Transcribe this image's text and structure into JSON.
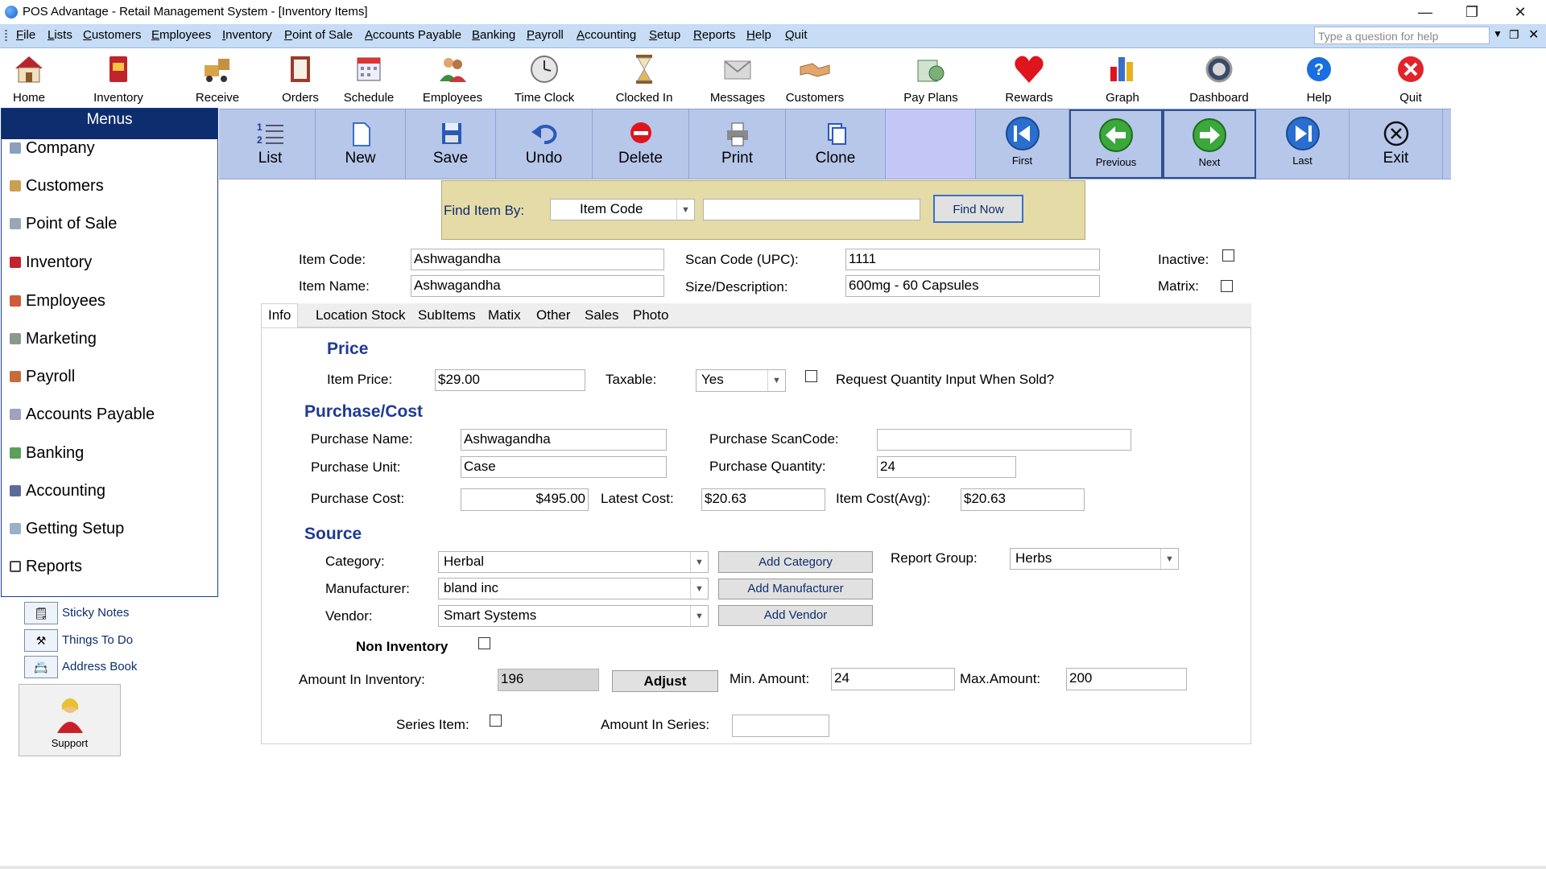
{
  "window": {
    "title": "POS Advantage - Retail Management System - [Inventory Items]",
    "controls": {
      "minimize": "—",
      "restore": "❐",
      "close": "✕"
    }
  },
  "menubar": {
    "items": [
      "File",
      "Lists",
      "Customers",
      "Employees",
      "Inventory",
      "Point of Sale",
      "Accounts Payable",
      "Banking",
      "Payroll",
      "Accounting",
      "Setup",
      "Reports",
      "Help",
      "Quit"
    ],
    "help_placeholder": "Type a question for help"
  },
  "toolbar": {
    "buttons": [
      {
        "label": "Home",
        "icon": "house-icon"
      },
      {
        "label": "Inventory",
        "icon": "book-icon"
      },
      {
        "label": "Receive",
        "icon": "forklift-icon"
      },
      {
        "label": "Orders",
        "icon": "notebook-icon"
      },
      {
        "label": "Schedule",
        "icon": "calendar-icon"
      },
      {
        "label": "Employees",
        "icon": "people-icon"
      },
      {
        "label": "Time Clock",
        "icon": "clock-icon"
      },
      {
        "label": "Clocked In",
        "icon": "hourglass-icon"
      },
      {
        "label": "Messages",
        "icon": "envelope-icon"
      },
      {
        "label": "Customers",
        "icon": "handshake-icon"
      },
      {
        "label": "Pay Plans",
        "icon": "money-icon"
      },
      {
        "label": "Rewards",
        "icon": "heart-icon"
      },
      {
        "label": "Graph",
        "icon": "bar-chart-icon"
      },
      {
        "label": "Dashboard",
        "icon": "gauge-icon"
      },
      {
        "label": "Help",
        "icon": "question-icon"
      },
      {
        "label": "Quit",
        "icon": "close-circle-icon"
      }
    ]
  },
  "leftpanel": {
    "header": "Menus",
    "items": [
      "Company",
      "Customers",
      "Point of Sale",
      "Inventory",
      "Employees",
      "Marketing",
      "Payroll",
      "Accounts Payable",
      "Banking",
      "Accounting",
      "Getting Setup",
      "Reports"
    ],
    "links": [
      "Sticky Notes",
      "Things To Do",
      "Address Book"
    ],
    "support": "Support"
  },
  "recordbar": {
    "list": "List",
    "new": "New",
    "save": "Save",
    "undo": "Undo",
    "delete": "Delete",
    "print": "Print",
    "clone": "Clone",
    "first": "First",
    "previous": "Previous",
    "next": "Next",
    "last": "Last",
    "exit": "Exit"
  },
  "find": {
    "label": "Find Item By:",
    "by_value": "Item Code",
    "search_value": "",
    "button": "Find Now"
  },
  "item": {
    "code_label": "Item Code:",
    "code": "Ashwagandha",
    "name_label": "Item Name:",
    "name": "Ashwagandha",
    "scan_label": "Scan Code (UPC):",
    "scan": "1111",
    "size_label": "Size/Description:",
    "size": "600mg - 60 Capsules",
    "inactive_label": "Inactive:",
    "matrix_label": "Matrix:",
    "inactive": false,
    "matrix": false
  },
  "tabs": [
    "Info",
    "Location Stock",
    "SubItems",
    "Matix",
    "Other",
    "Sales",
    "Photo"
  ],
  "info": {
    "price_title": "Price",
    "price_label": "Item Price:",
    "price": "$29.00",
    "taxable_label": "Taxable:",
    "taxable": "Yes",
    "request_qty_label": "Request Quantity Input When Sold?",
    "purchase_title": "Purchase/Cost",
    "purchase_name_label": "Purchase Name:",
    "purchase_name": "Ashwagandha",
    "purchase_scan_label": "Purchase ScanCode:",
    "purchase_scan": "",
    "purchase_unit_label": "Purchase Unit:",
    "purchase_unit": "Case",
    "purchase_qty_label": "Purchase Quantity:",
    "purchase_qty": "24",
    "purchase_cost_label": "Purchase Cost:",
    "purchase_cost": "$495.00",
    "latest_cost_label": "Latest Cost:",
    "latest_cost": "$20.63",
    "avg_cost_label": "Item Cost(Avg):",
    "avg_cost": "$20.63",
    "source_title": "Source",
    "category_label": "Category:",
    "category": "Herbal",
    "add_category": "Add Category",
    "report_group_label": "Report Group:",
    "report_group": "Herbs",
    "manufacturer_label": "Manufacturer:",
    "manufacturer": "bland inc",
    "add_manufacturer": "Add Manufacturer",
    "vendor_label": "Vendor:",
    "vendor": "Smart Systems",
    "add_vendor": "Add Vendor",
    "non_inventory_label": "Non Inventory",
    "amount_label": "Amount In Inventory:",
    "amount": "196",
    "adjust": "Adjust",
    "min_label": "Min. Amount:",
    "min": "24",
    "max_label": "Max.Amount:",
    "max": "200",
    "series_label": "Series Item:",
    "series_amount_label": "Amount In Series:",
    "series_amount": ""
  },
  "colors": {
    "panel_header": "#0d2d6e",
    "record_bar": "#b6c7ea",
    "find_bar": "#e4dba7",
    "section_title": "#1f3a93"
  }
}
